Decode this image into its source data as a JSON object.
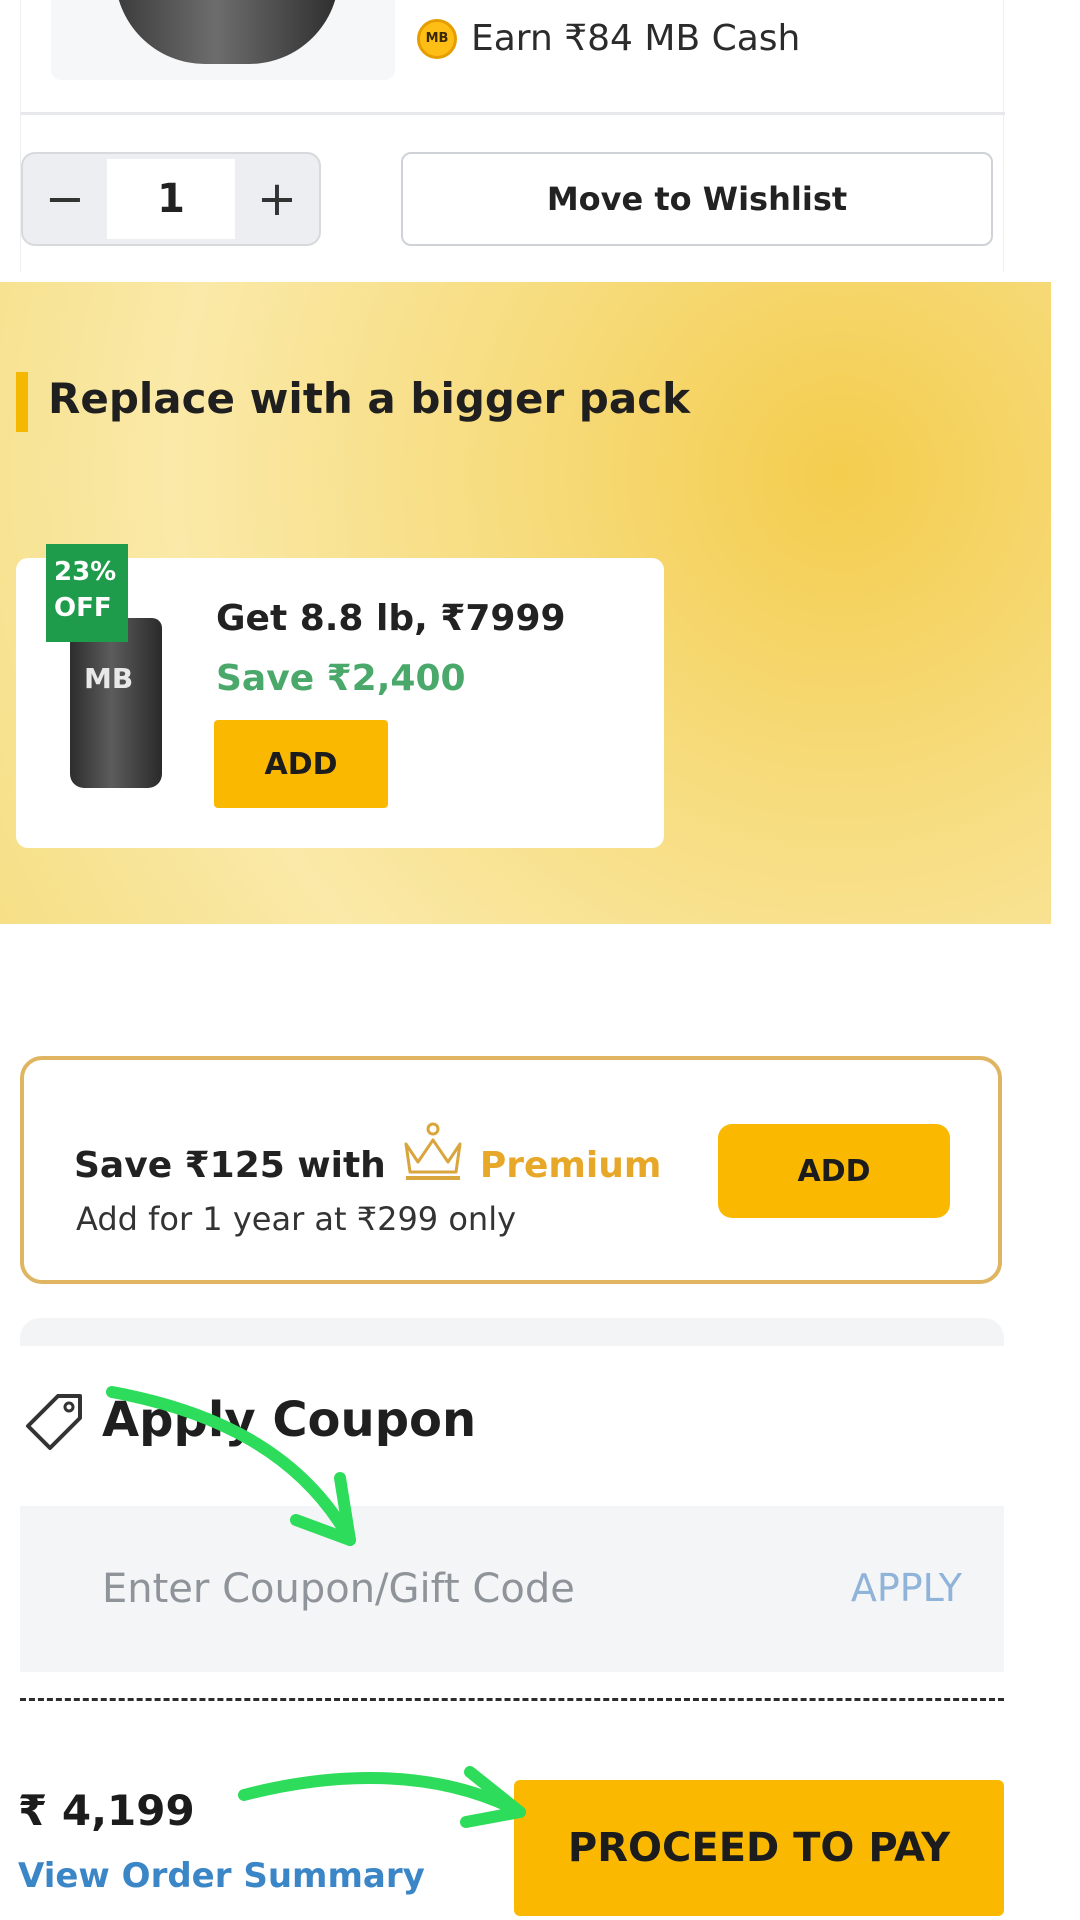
{
  "product": {
    "cash_text": "Earn ₹84 MB Cash",
    "coin_label": "MB",
    "quantity": "1",
    "minus_label": "−",
    "plus_label": "+",
    "wishlist_label": "Move to Wishlist"
  },
  "bigger_pack": {
    "title": "Replace with a bigger pack",
    "badge": "23% OFF",
    "jar_label": "MB",
    "name": "Get 8.8 lb, ₹7999",
    "save": "Save ₹2,400",
    "add_label": "ADD"
  },
  "premium": {
    "save_text": "Save ₹125 with",
    "brand": "Premium",
    "subtext": "Add for 1 year at ₹299 only",
    "add_label": "ADD"
  },
  "coupon": {
    "title": "Apply Coupon",
    "placeholder": "Enter Coupon/Gift Code",
    "apply_label": "APPLY"
  },
  "footer": {
    "total": "₹ 4,199",
    "summary_link": "View Order Summary",
    "proceed_label": "PROCEED TO PAY"
  },
  "colors": {
    "accent": "#fbb800",
    "save_green": "#49a86a",
    "link_blue": "#3b86c6",
    "annotation_green": "#2ddc5a"
  }
}
